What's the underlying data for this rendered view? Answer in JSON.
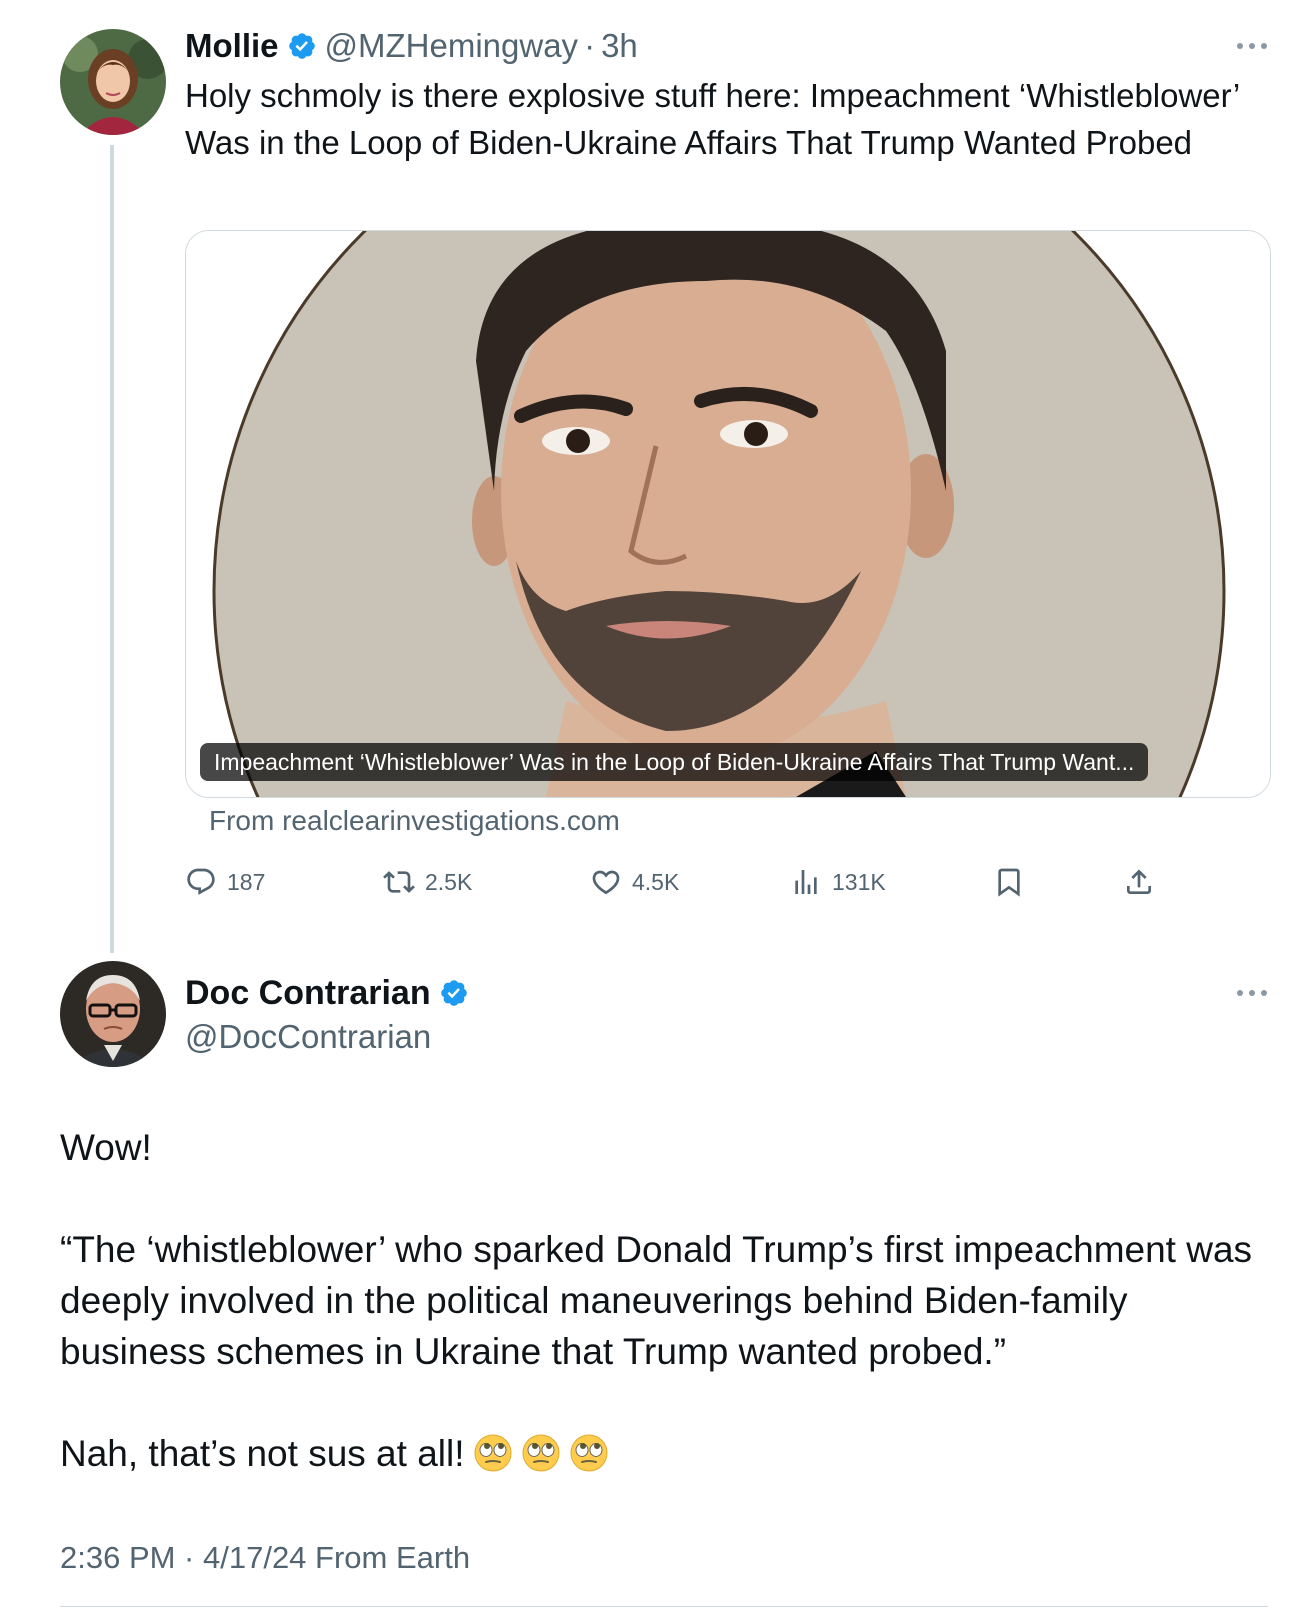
{
  "parent_tweet": {
    "author_name": "Mollie",
    "author_handle": "@MZHemingway",
    "separator": "·",
    "time_ago": "3h",
    "text": "Holy schmoly is there explosive stuff here: Impeachment ‘Whistleblower’ Was in the Loop of Biden-Ukraine Affairs That Trump Wanted Probed",
    "link_card": {
      "caption": "Impeachment ‘Whistleblower’ Was in the Loop of Biden-Ukraine Affairs That Trump Want...",
      "source": "From realclearinvestigations.com"
    },
    "actions": {
      "replies": "187",
      "reposts": "2.5K",
      "likes": "4.5K",
      "views": "131K"
    }
  },
  "reply_tweet": {
    "author_name": "Doc Contrarian",
    "author_handle": "@DocContrarian",
    "lines": [
      "Wow!",
      "“The ‘whistleblower’ who sparked Donald Trump’s first impeachment was deeply involved in the political maneuverings behind Biden-family business schemes in Ukraine that Trump wanted probed.”",
      "Nah, that’s not sus at all!"
    ],
    "emojis": [
      "eye-roll-emoji",
      "eye-roll-emoji",
      "eye-roll-emoji"
    ],
    "timestamp": "2:36 PM · 4/17/24 From Earth"
  },
  "colors": {
    "text": "#0f1419",
    "secondary": "#536471",
    "verified": "#1d9bf0",
    "border": "#cfd9de"
  }
}
